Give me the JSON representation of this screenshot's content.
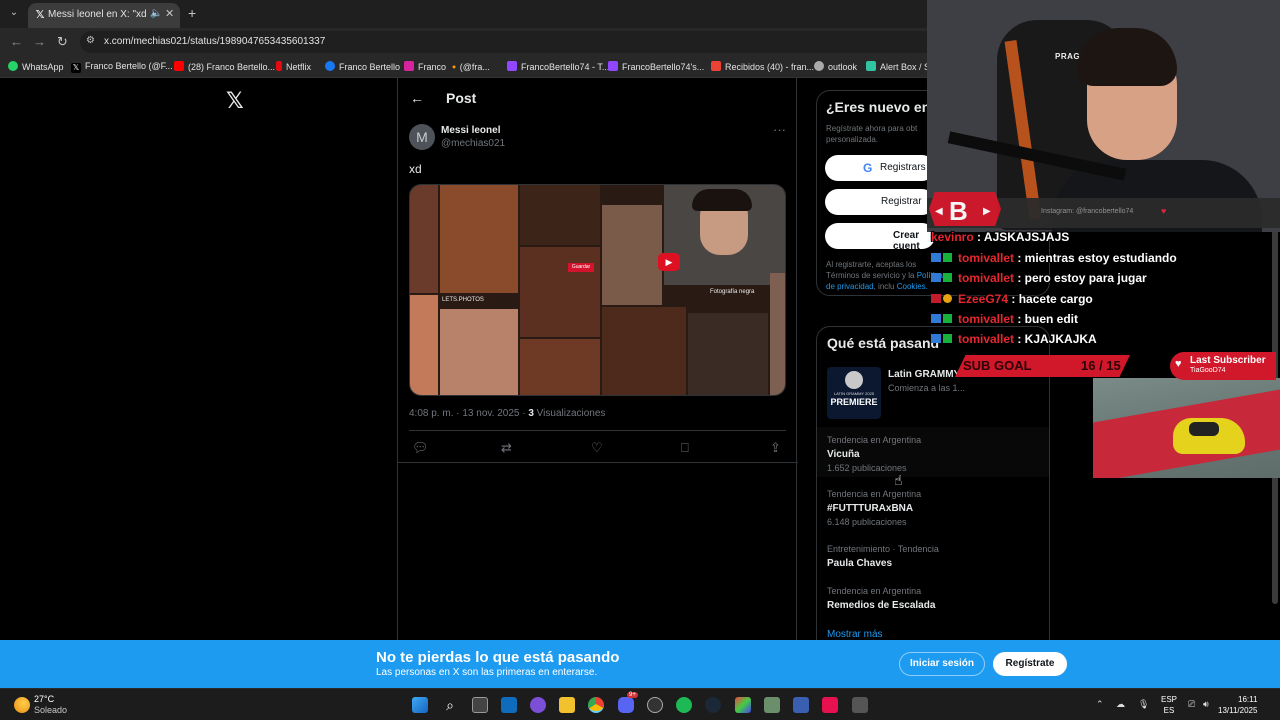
{
  "browser": {
    "tab_title": "Messi leonel en X: \"xd http",
    "url": "x.com/mechias021/status/1989047653435601337",
    "bookmarks": [
      {
        "label": "WhatsApp",
        "color": "#25d366"
      },
      {
        "label": "Franco Bertello (@F...",
        "color": "#ffffff"
      },
      {
        "label": "(28) Franco Bertello...",
        "color": "#ff0000"
      },
      {
        "label": "Netflix",
        "color": "#e50914"
      },
      {
        "label": "Franco Bertello",
        "color": "#1877f2"
      },
      {
        "label": "Franco 🔸(@fra...",
        "color": "#d6249f"
      },
      {
        "label": "FrancoBertello74 - T...",
        "color": "#9146ff"
      },
      {
        "label": "FrancoBertello74's...",
        "color": "#9146ff"
      },
      {
        "label": "Recibidos (40) - fran...",
        "color": "#ea4335"
      },
      {
        "label": "outlook",
        "color": "#aaaaaa"
      },
      {
        "label": "Alert Box / St",
        "color": "#31c3a2"
      }
    ]
  },
  "post": {
    "header": "Post",
    "avatar_letter": "M",
    "name": "Messi leonel",
    "handle": "@mechias021",
    "text": "xd",
    "time": "4:08 p. m. · 13 nov. 2025 · ",
    "views_count": "3",
    "views_label": " Visualizaciones",
    "media_labels": {
      "tag": "Guardar",
      "photo_tag": "LETS.PHOTOS",
      "caption": "Fotografía negra"
    }
  },
  "signup": {
    "title": "¿Eres nuevo en",
    "desc": "Regístrate ahora para obt personalizada.",
    "google": "Registrars",
    "apple": "Registrar",
    "create": "Crear cuent",
    "legal_1": "Al registrarte, aceptas los Términos de servicio y la",
    "legal_link_1": "Política de privacidad",
    "legal_2": ", inclu",
    "legal_link_2": "Cookies."
  },
  "trends": {
    "title": "Qué está pasand",
    "event": {
      "name": "Latin GRAMMY",
      "sub": "Comienza a las 1...",
      "badge": "PREMIERE",
      "badge_top": "LATIN GRAMMY 2025"
    },
    "items": [
      {
        "category": "Tendencia en Argentina",
        "name": "Vicuña",
        "count": "1.652 publicaciones"
      },
      {
        "category": "Tendencia en Argentina",
        "name": "#FUTTTURAxBNA",
        "count": "6.148 publicaciones"
      },
      {
        "category": "Entretenimiento · Tendencia",
        "name": "Paula Chaves",
        "count": ""
      },
      {
        "category": "Tendencia en Argentina",
        "name": "Remedios de Escalada",
        "count": ""
      }
    ],
    "more": "Mostrar más"
  },
  "banner": {
    "title": "No te pierdas lo que está pasando",
    "subtitle": "Las personas en X son las primeras en enterarse.",
    "login": "Iniciar sesión",
    "signup": "Regístrate"
  },
  "overlay": {
    "chair_brand": "PRAGMA",
    "instagram": "Instagram: @francobertello74",
    "chat": [
      {
        "user": "kevinro",
        "message": " : AJSKAJSJAJS"
      },
      {
        "user": "tomivallet",
        "message": " : mientras estoy estudiando"
      },
      {
        "user": "tomivallet",
        "message": " : pero estoy para jugar"
      },
      {
        "user": "EzeeG74",
        "message": " : hacete cargo"
      },
      {
        "user": "tomivallet",
        "message": " : buen edit"
      },
      {
        "user": "tomivallet",
        "message": " : KJAJKAJKA"
      }
    ],
    "sub_goal_label": "SUB GOAL",
    "sub_goal_value": "16 / 15",
    "sub_goal_progress": 1.0,
    "last_sub_title": "Last Subscriber",
    "last_sub_name": "TiaGooD74"
  },
  "taskbar": {
    "temp": "27°C",
    "weather": "Soleado",
    "lang_1": "ESP",
    "lang_2": "ES",
    "time": "16:11",
    "date": "13/11/2025",
    "discord_badge": "9+"
  }
}
